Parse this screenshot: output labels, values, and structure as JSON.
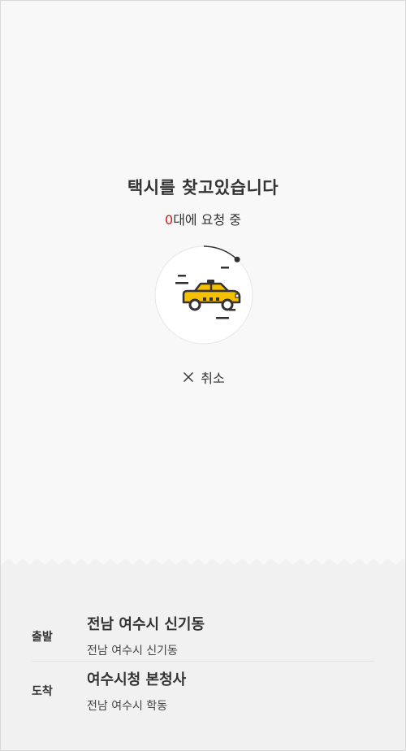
{
  "search": {
    "title": "택시를 찾고있습니다",
    "request_count": "0",
    "request_suffix": "대에 요청 중",
    "progress_fraction": 0.12,
    "cancel_label": "취소"
  },
  "route": {
    "departure": {
      "label": "출발",
      "place": "전남 여수시 신기동",
      "address": "전남 여수시 신기동"
    },
    "arrival": {
      "label": "도착",
      "place": "여수시청 본청사",
      "address": "전남 여수시 학동"
    }
  },
  "colors": {
    "accent_red": "#c81e1e",
    "taxi_yellow": "#f5c000",
    "dark": "#333333",
    "background": "#f8f8f8",
    "route_background": "#f1f1f1"
  },
  "icons": {
    "cancel": "close-icon",
    "taxi": "taxi-icon"
  }
}
